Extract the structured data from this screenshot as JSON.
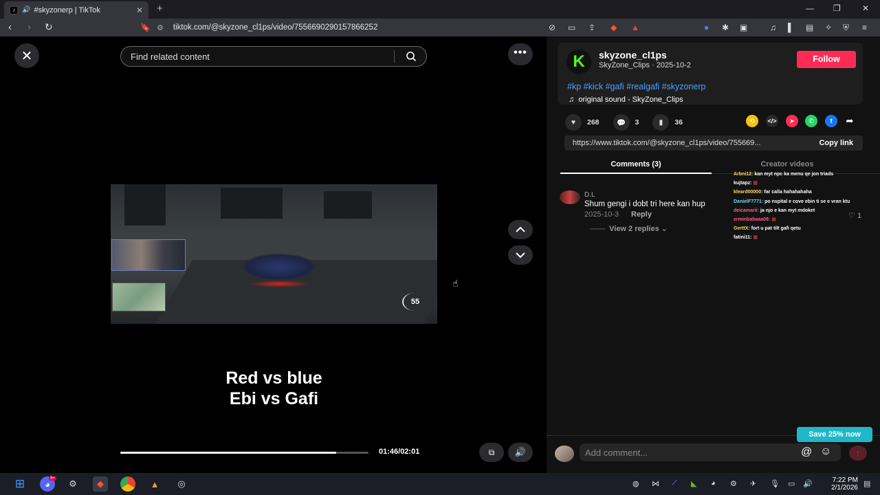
{
  "browser": {
    "tab_title": "#skyzonerp | TikTok",
    "url": "tiktok.com/@skyzone_cl1ps/video/7556690290157866252"
  },
  "video": {
    "search_placeholder": "Find related content",
    "caption_line1": "Red vs blue",
    "caption_line2": "Ebi vs Gafi",
    "time": "01:46/02:01",
    "progress_fraction": 0.87,
    "speed": "55"
  },
  "creator": {
    "username": "skyzone_cl1ps",
    "subline": "SkyZone_Clips · 2025-10-2",
    "follow_label": "Follow",
    "hashtags": "#kp #kick #gafi #realgafi #skyzonerp",
    "sound": "original sound - SkyZone_Clips"
  },
  "stats": {
    "likes": "268",
    "comments": "3",
    "saves": "36"
  },
  "share": {
    "link": "https://www.tiktok.com/@skyzone_cl1ps/video/755669...",
    "copy_label": "Copy link"
  },
  "tabs": {
    "comments": "Comments (3)",
    "creator_videos": "Creator videos"
  },
  "comment": {
    "author": "D.L",
    "text": "Shum gengi i dobt tri here kan hup",
    "date": "2025-10-3",
    "reply": "Reply",
    "likes": "1",
    "view_replies": "View 2 replies"
  },
  "chat_overlay": [
    {
      "name": "Arbni12:",
      "msg": "kan myt npc ka menu qe jon triads"
    },
    {
      "name": "kujtapz:",
      "msg": ""
    },
    {
      "name": "kleard00000:",
      "msg": "far calla hahahahaha"
    },
    {
      "name": "DanielF7771:",
      "msg": "po nspital e cove ebin ti se e vran ktu"
    },
    {
      "name": "deicamarii:",
      "msg": "ja njo e kan myt mdoket"
    },
    {
      "name": "erminbabaaa08:",
      "msg": ""
    },
    {
      "name": "GerttX:",
      "msg": "fort u pat tilt gafi qetu"
    },
    {
      "name": "fatini11:",
      "msg": ""
    }
  ],
  "promo": {
    "save_label": "Save 25% now"
  },
  "add_comment": {
    "placeholder": "Add comment..."
  },
  "taskbar": {
    "time": "7:22 PM",
    "date": "2/1/2026",
    "discord_badge": "9+"
  },
  "colors": {
    "follow": "#fe2c55",
    "hashtag": "#4fa0ff",
    "promo": "#20b7c8",
    "kick_green": "#53fc18"
  }
}
